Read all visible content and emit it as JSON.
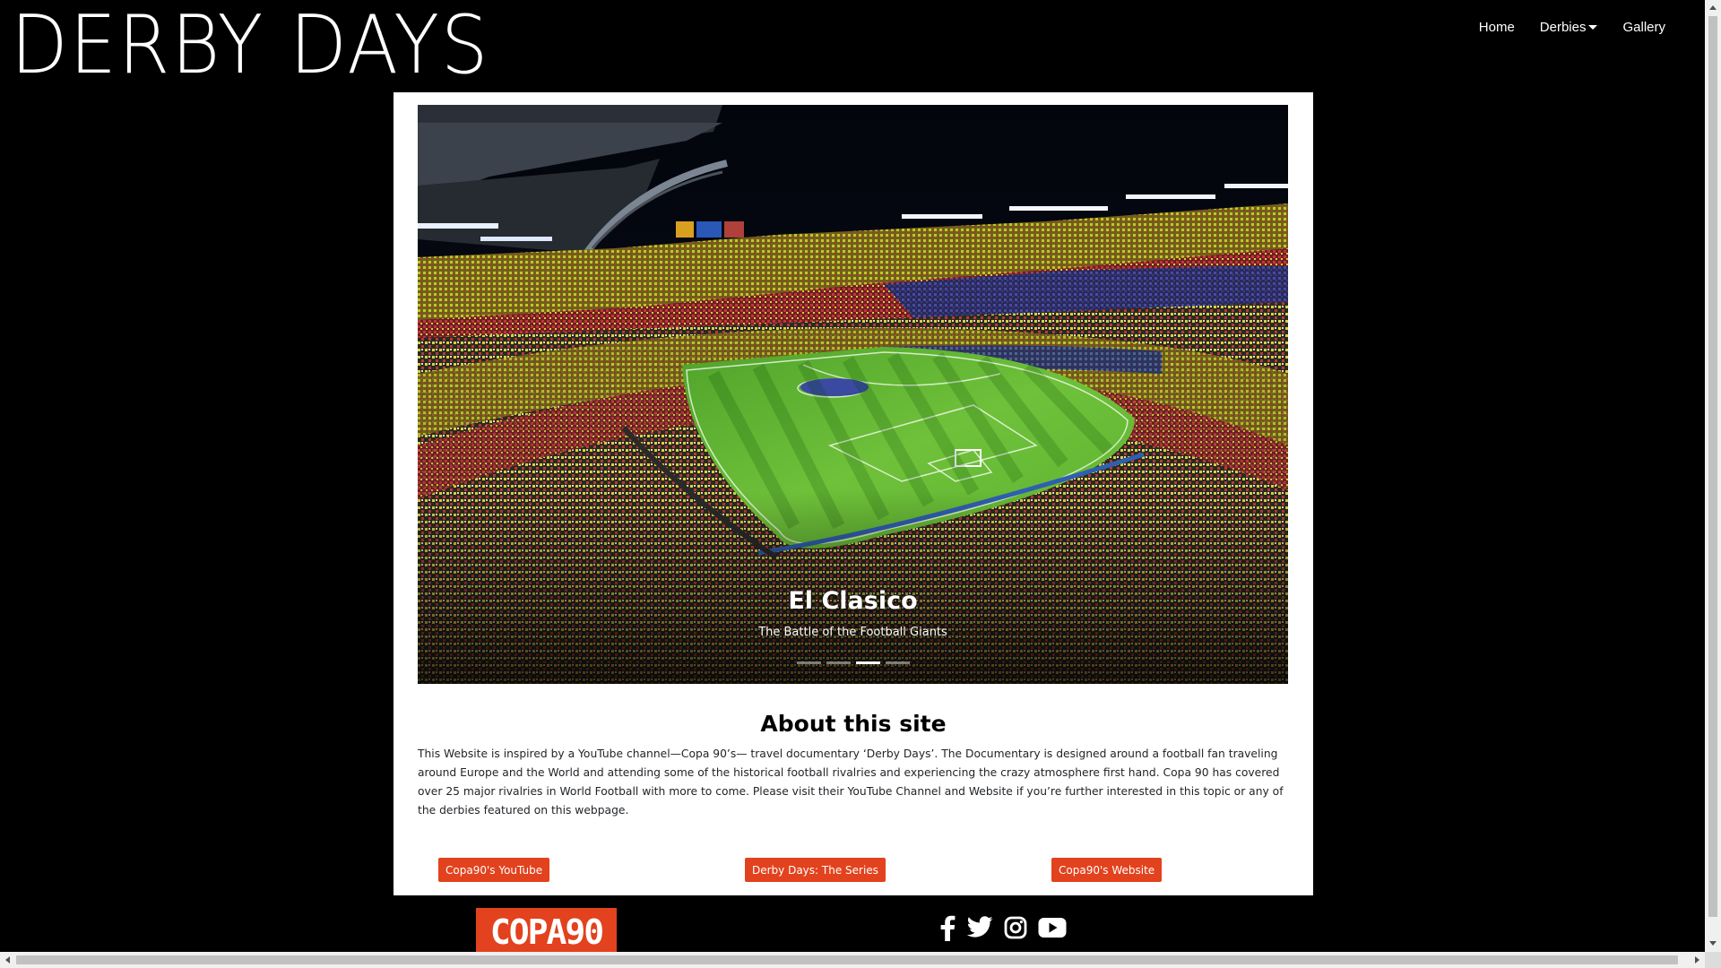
{
  "header": {
    "brand": "DERBY DAYS",
    "nav": {
      "home": "Home",
      "derbies": "Derbies",
      "gallery": "Gallery"
    }
  },
  "carousel": {
    "active_index": 2,
    "slide_count": 4,
    "title": "El Clasico",
    "subtitle": "The Battle of the Football Giants"
  },
  "about": {
    "title": "About this site",
    "text": "This Website is inspired by a YouTube channel—Copa 90’s— travel documentary ‘Derby Days’. The Documentary is designed around a football fan traveling around Europe and the World and attending some of the historical football rivalries and experiencing the crazy atmosphere first hand. Copa 90 has covered over 25 major rivalries in World Football with more to come. Please visit their YouTube Channel and Website if you’re further interested in this topic or any of the derbies featured on this webpage."
  },
  "buttons": {
    "youtube": "Copa90's YouTube",
    "series": "Derby Days: The Series",
    "website": "Copa90's Website"
  },
  "footer": {
    "logo": "COPA90",
    "social_icons": [
      "facebook-icon",
      "twitter-icon",
      "instagram-icon",
      "youtube-icon"
    ]
  },
  "colors": {
    "accent": "#e2421d",
    "background": "#000000",
    "card": "#ffffff"
  }
}
